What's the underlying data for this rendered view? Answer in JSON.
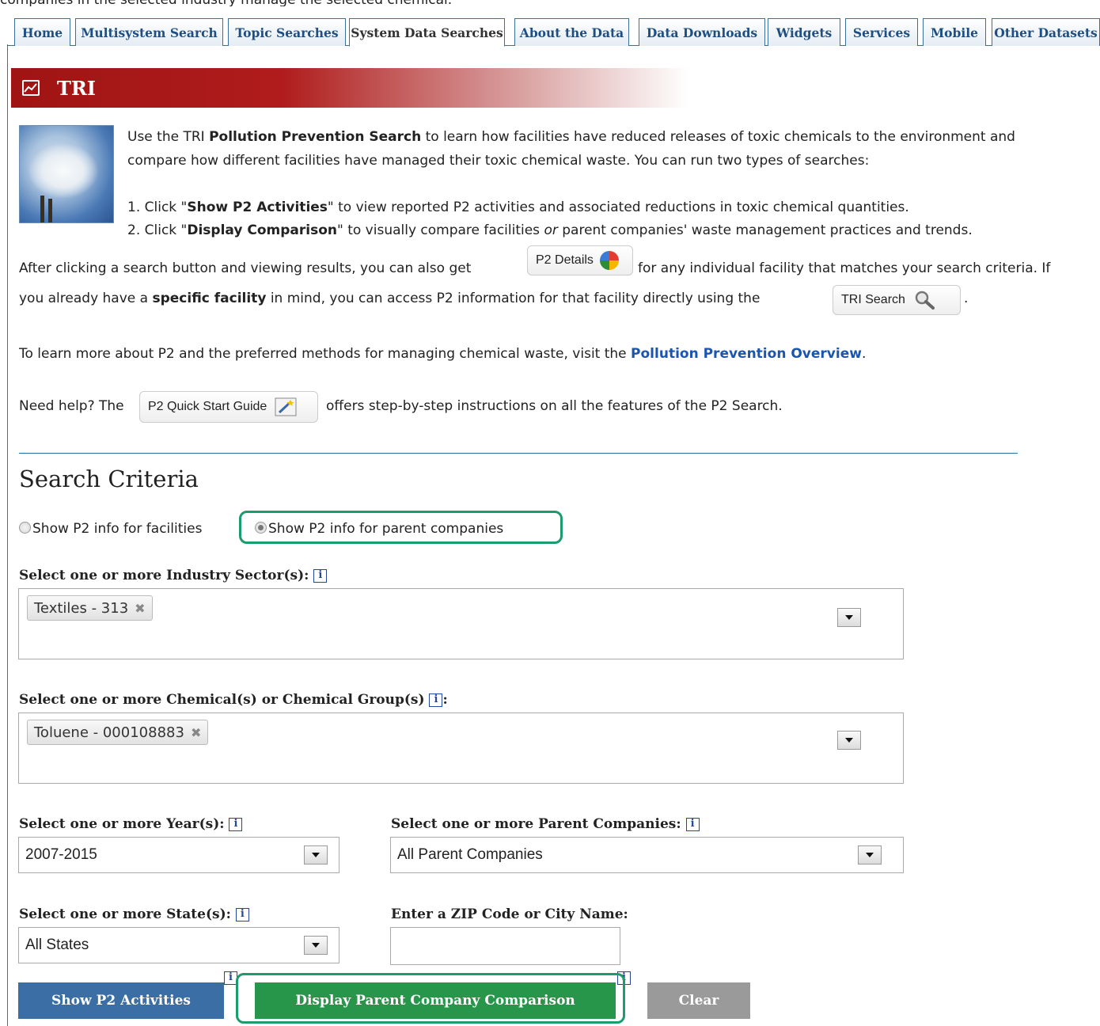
{
  "top_cut_text": "companies in the selected industry manage the selected chemical.",
  "tabs": [
    {
      "label": "Home",
      "active": false
    },
    {
      "label": "Multisystem Search",
      "active": false
    },
    {
      "label": "Topic Searches",
      "active": false
    },
    {
      "label": "System Data Searches",
      "active": true
    },
    {
      "label": "About the Data",
      "active": false
    },
    {
      "label": "Data Downloads",
      "active": false
    },
    {
      "label": "Widgets",
      "active": false
    },
    {
      "label": "Services",
      "active": false
    },
    {
      "label": "Mobile",
      "active": false
    },
    {
      "label": "Other Datasets",
      "active": false
    }
  ],
  "banner": {
    "title": "TRI",
    "icon": "chart-icon",
    "color": "#a01414"
  },
  "intro": {
    "p1_a": "Use the TRI ",
    "p1_bold": "Pollution Prevention Search",
    "p1_b": " to learn how facilities have reduced releases of toxic chemicals to the environment and",
    "p1_line2": "compare how different facilities have managed their toxic chemical waste. You can run two types of searches:",
    "step1_a": "1. Click \"",
    "step1_bold": "Show P2 Activities",
    "step1_b": "\" to view reported P2 activities and associated reductions in toxic chemical quantities.",
    "step2_a": "2. Click \"",
    "step2_bold": "Display Comparison",
    "step2_b": "\" to visually compare facilities ",
    "step2_or": "or",
    "step2_c": " parent companies' waste management practices and trends.",
    "after_a": "After clicking a search button and viewing results, you can also get",
    "p2_details_btn": "P2 Details",
    "after_b": "for any individual facility that matches your search criteria. If",
    "line_b_a": "you already have a ",
    "line_b_bold": "specific facility",
    "line_b_b": " in mind, you can access P2 information for that facility directly using the",
    "tri_search_btn": "TRI Search",
    "line_b_end": ".",
    "learn_a": "To learn more about P2 and the preferred methods for managing chemical waste, visit the ",
    "learn_link": "Pollution Prevention Overview",
    "learn_end": ".",
    "help_a": "Need help? The",
    "quick_start_btn": "P2 Quick Start Guide",
    "help_b": "offers step-by-step instructions on all the features of the P2 Search."
  },
  "search": {
    "heading": "Search Criteria",
    "radio_facilities": "Show P2 info for facilities",
    "radio_parent": "Show P2 info for parent companies",
    "selected_radio": "parent",
    "industry_label": "Select one or more Industry Sector(s):",
    "industry_chip": "Textiles - 313",
    "chemical_label": "Select one or more Chemical(s) or Chemical Group(s)",
    "chemical_colon": ":",
    "chemical_chip": "Toluene - 000108883",
    "year_label": "Select one or more Year(s):",
    "year_value": "2007-2015",
    "parent_label": "Select one or more Parent Companies:",
    "parent_value": "All Parent Companies",
    "state_label": "Select one or more State(s):",
    "state_value": "All States",
    "zip_label": "Enter a ZIP Code or City Name:",
    "zip_value": "",
    "info_glyph": "i"
  },
  "buttons": {
    "show_p2": "Show P2 Activities",
    "display_comparison": "Display Parent Company Comparison",
    "clear": "Clear"
  },
  "colors": {
    "show_p2": "#3b6ea5",
    "display_comparison": "#27964b",
    "clear": "#9a9a9a",
    "highlight": "#1a9c6c"
  }
}
